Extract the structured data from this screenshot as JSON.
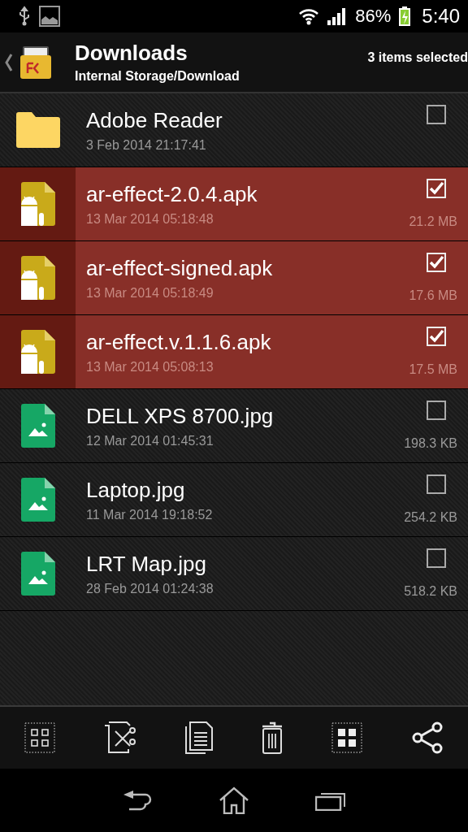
{
  "status_bar": {
    "battery": "86%",
    "time": "5:40"
  },
  "header": {
    "title": "Downloads",
    "path": "Internal Storage/Download",
    "selection": "3 items selected"
  },
  "files": [
    {
      "kind": "folder",
      "name": "Adobe Reader",
      "date": "3 Feb 2014 21:17:41",
      "selected": false
    },
    {
      "kind": "apk",
      "name": "ar-effect-2.0.4.apk",
      "date": "13 Mar 2014 05:18:48",
      "size": "21.2 MB",
      "selected": true
    },
    {
      "kind": "apk",
      "name": "ar-effect-signed.apk",
      "date": "13 Mar 2014 05:18:49",
      "size": "17.6 MB",
      "selected": true
    },
    {
      "kind": "apk",
      "name": "ar-effect.v.1.1.6.apk",
      "date": "13 Mar 2014 05:08:13",
      "size": "17.5 MB",
      "selected": true
    },
    {
      "kind": "image",
      "name": "DELL XPS 8700.jpg",
      "date": "12 Mar 2014 01:45:31",
      "size": "198.3 KB",
      "selected": false
    },
    {
      "kind": "image",
      "name": "Laptop.jpg",
      "date": "11 Mar 2014 19:18:52",
      "size": "254.2 KB",
      "selected": false
    },
    {
      "kind": "image",
      "name": "LRT Map.jpg",
      "date": "28 Feb 2014 01:24:38",
      "size": "518.2 KB",
      "selected": false
    }
  ]
}
